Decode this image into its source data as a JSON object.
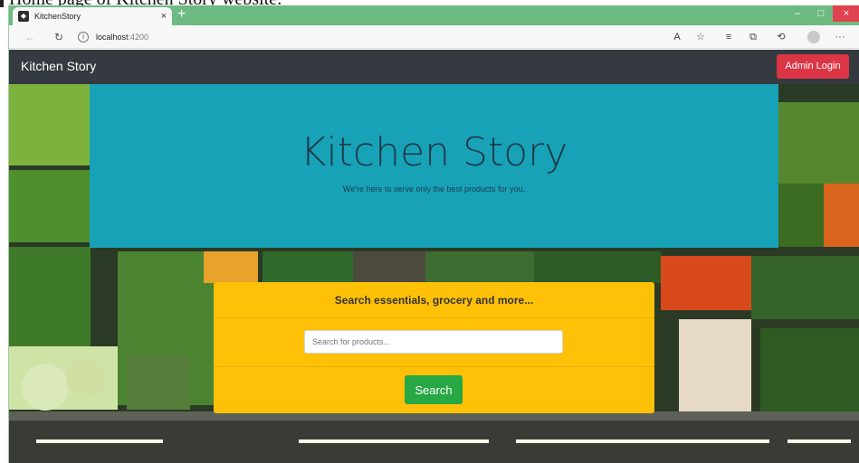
{
  "caption": {
    "text": "Home page of Kitchen Story website:"
  },
  "browser": {
    "tab_title": "KitchenStory",
    "tab_close": "×",
    "new_tab": "+",
    "url_host": "localhost",
    "url_port": ":4200",
    "win_minimize": "–",
    "win_maximize": "□",
    "win_close": "×"
  },
  "navbar": {
    "brand": "Kitchen Story",
    "admin_login": "Admin Login"
  },
  "jumbotron": {
    "title": "Kitchen Story",
    "subtitle": "We're here to serve only the best products for you."
  },
  "search": {
    "header": "Search essentials, grocery and more...",
    "placeholder": "Search for products...",
    "button": "Search"
  },
  "colors": {
    "navbar": "#343a40",
    "admin_button": "#dc3545",
    "jumbotron": "#17a2b8",
    "search_card": "#ffc107",
    "search_button": "#28a745",
    "tabstrip": "#6dbb82"
  },
  "icons": [
    "back-icon",
    "refresh-icon",
    "info-icon",
    "read-aloud-icon",
    "favorite-icon",
    "favorites-list-icon",
    "collections-icon",
    "history-icon",
    "profile-icon",
    "more-icon",
    "angular-favicon"
  ]
}
